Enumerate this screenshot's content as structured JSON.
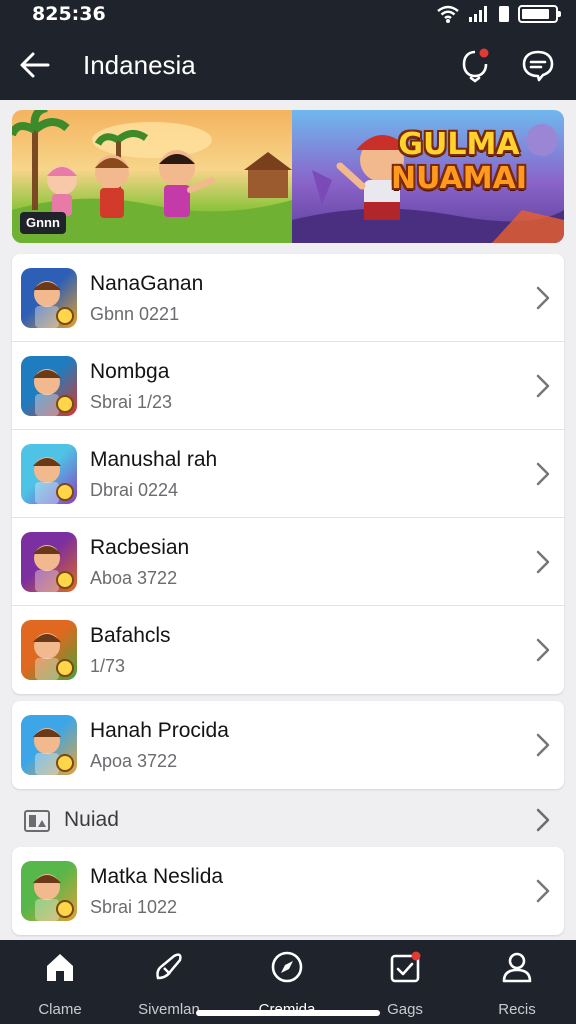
{
  "status": {
    "time": "825:36",
    "battery_level": 0.85
  },
  "header": {
    "title": "Indanesia"
  },
  "banner": {
    "badge": "Gnnn",
    "title_line1": "GULMA",
    "title_line2": "NUAMAI"
  },
  "list_top": [
    {
      "name": "NanaGanan",
      "sub": "Gbnn 0221",
      "thumb": [
        "#2d5fb7",
        "#e7a12a"
      ]
    },
    {
      "name": "Nombga",
      "sub": "Sbrai 1/23",
      "thumb": [
        "#1f7dbf",
        "#d9362b"
      ]
    },
    {
      "name": "Manushal rah",
      "sub": "Dbrai 0224",
      "thumb": [
        "#4ec3e6",
        "#8a3fc1"
      ]
    },
    {
      "name": "Racbesian",
      "sub": "Aboa 3722",
      "thumb": [
        "#7c2fa0",
        "#e36a1f"
      ]
    },
    {
      "name": "Bafahcls",
      "sub": "1/73",
      "thumb": [
        "#e06820",
        "#46a33a"
      ]
    }
  ],
  "list_single": [
    {
      "name": "Hanah Procida",
      "sub": "Apoa 3722",
      "thumb": [
        "#3ca6e8",
        "#e8a23a"
      ]
    }
  ],
  "section": {
    "label": "Nuiad"
  },
  "list_bottom": [
    {
      "name": "Matka Neslida",
      "sub": "Sbrai 1022",
      "thumb": [
        "#57b74a",
        "#e0a03a"
      ]
    }
  ],
  "tabs": [
    {
      "label": "Clame",
      "icon": "home-icon"
    },
    {
      "label": "Sivemlan",
      "icon": "brush-icon"
    },
    {
      "label": "Cremida",
      "icon": "compass-icon"
    },
    {
      "label": "Gags",
      "icon": "calendar-check-icon"
    },
    {
      "label": "Recis",
      "icon": "profile-icon"
    }
  ],
  "colors": {
    "bar": "#1f242c",
    "background": "#efeff1",
    "badge_red": "#e53935"
  }
}
